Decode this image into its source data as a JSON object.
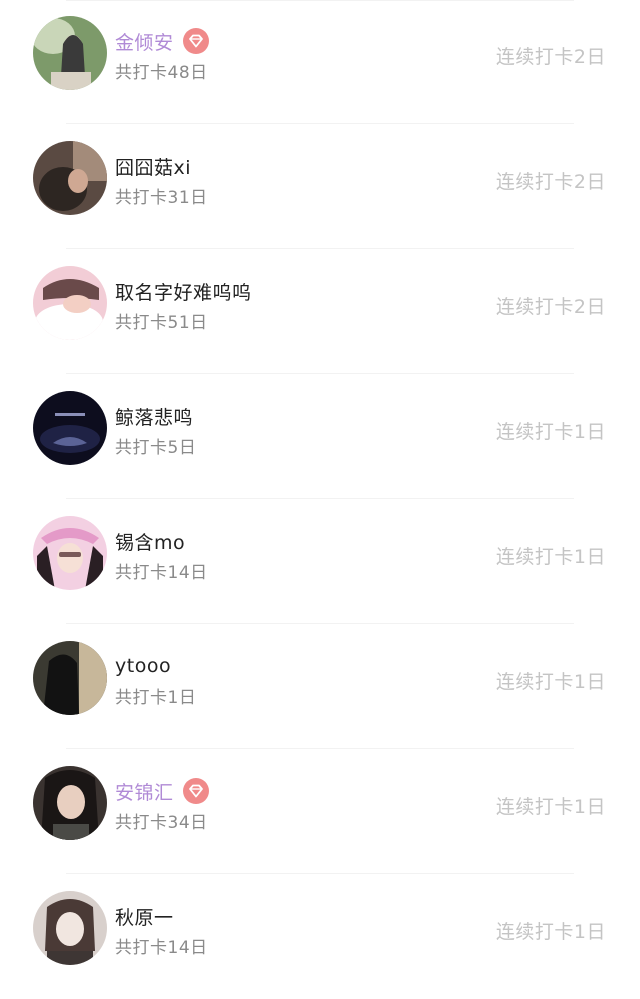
{
  "colors": {
    "vip_name": "#b08ad6",
    "vip_badge": "#f08a8a",
    "name": "#222222",
    "sub_text": "#8a8a8a",
    "streak_text": "#c4c4c4",
    "divider": "#f2f2f2"
  },
  "checkin_list": {
    "rows": [
      {
        "name": "金倾安",
        "vip": true,
        "badge_icon": "diamond-icon",
        "total": "共打卡48日",
        "streak": "连续打卡2日",
        "avatar_colors": [
          "#7d9a6a",
          "#c9d6b8",
          "#3a3a3a"
        ]
      },
      {
        "name": "囧囧菇xi",
        "vip": false,
        "total": "共打卡31日",
        "streak": "连续打卡2日",
        "avatar_colors": [
          "#5a4a42",
          "#a38b7a",
          "#2d2622"
        ]
      },
      {
        "name": "取名字好难呜呜",
        "vip": false,
        "total": "共打卡51日",
        "streak": "连续打卡2日",
        "avatar_colors": [
          "#f2cdd6",
          "#ffffff",
          "#6a4a4a"
        ]
      },
      {
        "name": "鲸落悲鸣",
        "vip": false,
        "total": "共打卡5日",
        "streak": "连续打卡1日",
        "avatar_colors": [
          "#0d0d1e",
          "#1f2245",
          "#8a8fb8"
        ]
      },
      {
        "name": "锡含mo",
        "vip": false,
        "total": "共打卡14日",
        "streak": "连续打卡1日",
        "avatar_colors": [
          "#e49ac8",
          "#f3d0e2",
          "#2a1f24"
        ]
      },
      {
        "name": "ytooo",
        "vip": false,
        "total": "共打卡1日",
        "streak": "连续打卡1日",
        "avatar_colors": [
          "#3b3a32",
          "#c7b79a",
          "#121212"
        ]
      },
      {
        "name": "安锦汇",
        "vip": true,
        "badge_icon": "diamond-icon",
        "total": "共打卡34日",
        "streak": "连续打卡1日",
        "avatar_colors": [
          "#3a3330",
          "#e8cfc0",
          "#1a1615"
        ]
      },
      {
        "name": "秋原一",
        "vip": false,
        "total": "共打卡14日",
        "streak": "连续打卡1日",
        "avatar_colors": [
          "#d8d0cc",
          "#f1e6e0",
          "#4a3a36"
        ]
      }
    ]
  }
}
